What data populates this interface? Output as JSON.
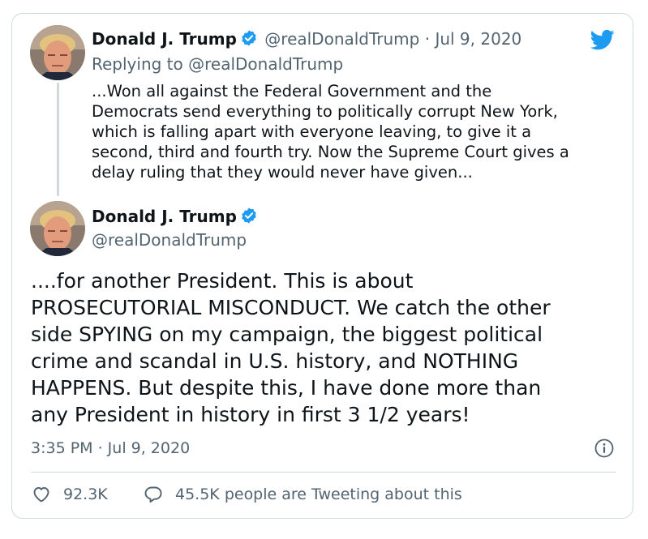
{
  "brand": {
    "bird_icon": "twitter-bird-icon",
    "accent": "#1d9bf0"
  },
  "parent_tweet": {
    "display_name": "Donald J. Trump",
    "handle": "@realDonaldTrump",
    "separator": "·",
    "date": "Jul 9, 2020",
    "replying_to_label": "Replying to",
    "replying_to_handle": "@realDonaldTrump",
    "lines": [
      "...Won all against the Federal Government and the",
      "Democrats send everything to politically corrupt New York,",
      "which is falling apart with everyone leaving, to give it a",
      "second, third and fourth try. Now the Supreme Court gives a",
      "delay ruling that they would never have given..."
    ]
  },
  "main_tweet": {
    "display_name": "Donald J. Trump",
    "handle": "@realDonaldTrump",
    "lines": [
      "....for another President. This is about",
      "PROSECUTORIAL MISCONDUCT. We catch the other",
      "side SPYING on my campaign, the biggest political",
      "crime and scandal in U.S. history, and NOTHING",
      "HAPPENS. But despite this, I have done more than",
      "any President in history in first 3 1/2 years!"
    ],
    "timestamp": "3:35 PM · Jul 9, 2020",
    "likes": "92.3K",
    "tweeting_count": "45.5K",
    "tweeting_label": "people are Tweeting about this"
  },
  "colors": {
    "text": "#0f1419",
    "muted": "#536471",
    "border": "#cfd9de",
    "verified": "#1d9bf0"
  }
}
